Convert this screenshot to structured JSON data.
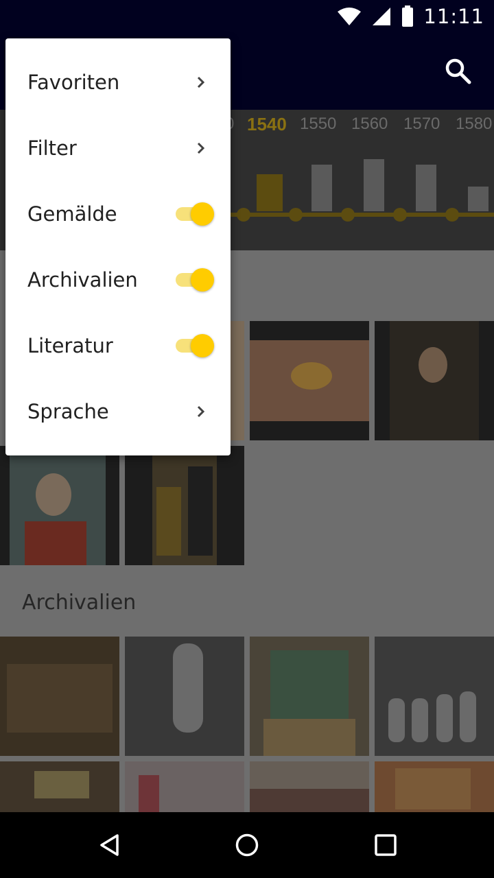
{
  "status_bar": {
    "time": "11:11",
    "icons": [
      "wifi-icon",
      "signal-icon",
      "battery-icon"
    ]
  },
  "toolbar": {
    "search_icon": "search-icon"
  },
  "timeline": {
    "year_labels": [
      "0",
      "1540",
      "1550",
      "1560",
      "1570",
      "1580"
    ],
    "selected_year": "1540",
    "accent_color": "#8a7112",
    "selected_label_color": "#b8961a"
  },
  "content": {
    "section_archivalien": "Archivalien"
  },
  "menu": {
    "items": [
      {
        "label": "Favoriten",
        "type": "submenu"
      },
      {
        "label": "Filter",
        "type": "submenu"
      },
      {
        "label": "Gemälde",
        "type": "toggle",
        "on": true
      },
      {
        "label": "Archivalien",
        "type": "toggle",
        "on": true
      },
      {
        "label": "Literatur",
        "type": "toggle",
        "on": true
      },
      {
        "label": "Sprache",
        "type": "submenu"
      }
    ],
    "toggle_color": "#ffcc00"
  },
  "nav_bar": {
    "icons": [
      "back-icon",
      "home-icon",
      "recents-icon"
    ]
  }
}
